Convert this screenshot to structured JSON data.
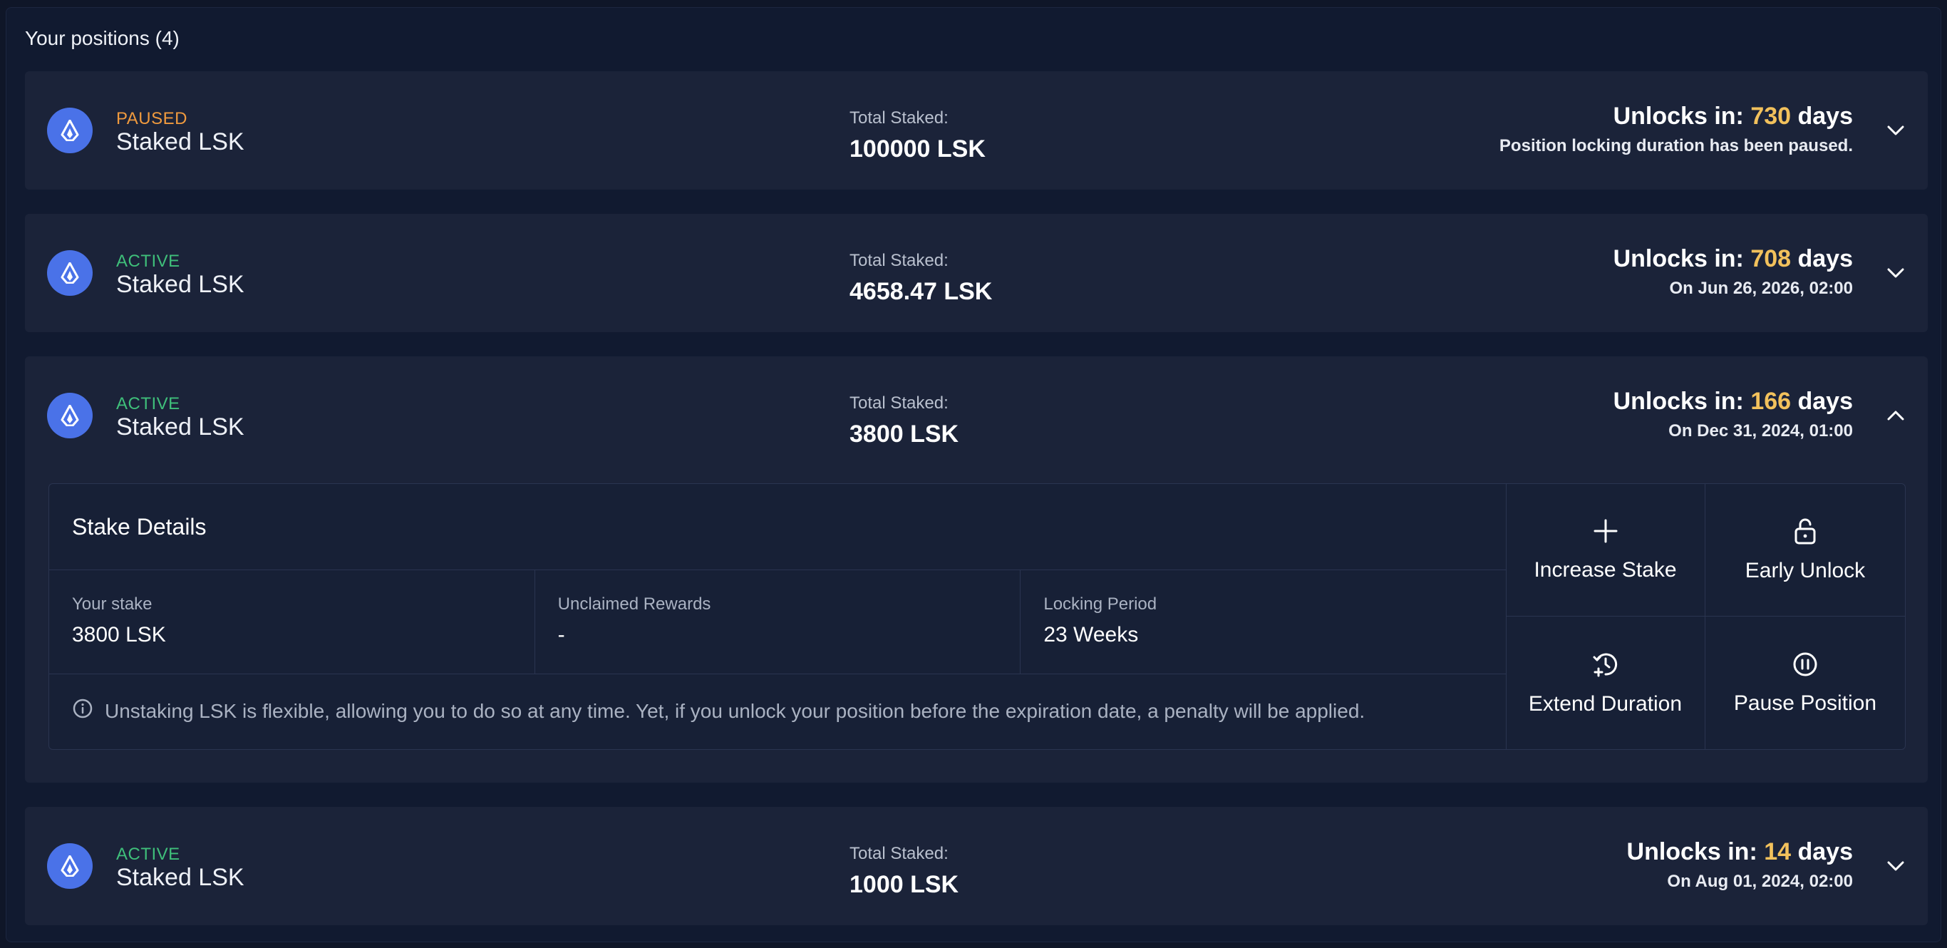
{
  "heading": "Your positions (4)",
  "staked_label": "Total Staked:",
  "unlock_prefix": "Unlocks in:",
  "unlock_suffix": "days",
  "positions": [
    {
      "status": "PAUSED",
      "name": "Staked LSK",
      "total_staked": "100000 LSK",
      "unlock_days": "730",
      "subtext": "Position locking duration has been paused.",
      "expanded": false
    },
    {
      "status": "ACTIVE",
      "name": "Staked LSK",
      "total_staked": "4658.47 LSK",
      "unlock_days": "708",
      "subtext": "On Jun 26, 2026, 02:00",
      "expanded": false
    },
    {
      "status": "ACTIVE",
      "name": "Staked LSK",
      "total_staked": "3800 LSK",
      "unlock_days": "166",
      "subtext": "On Dec 31, 2024, 01:00",
      "expanded": true
    },
    {
      "status": "ACTIVE",
      "name": "Staked LSK",
      "total_staked": "1000 LSK",
      "unlock_days": "14",
      "subtext": "On Aug 01, 2024, 02:00",
      "expanded": false
    }
  ],
  "details": {
    "title": "Stake Details",
    "fields": [
      {
        "label": "Your stake",
        "value": "3800 LSK"
      },
      {
        "label": "Unclaimed Rewards",
        "value": "-"
      },
      {
        "label": "Locking Period",
        "value": "23 Weeks"
      }
    ],
    "note": "Unstaking LSK is flexible, allowing you to do so at any time. Yet, if you unlock your position before the expiration date, a penalty will be applied.",
    "actions": [
      {
        "label": "Increase Stake",
        "icon": "plus-icon"
      },
      {
        "label": "Early Unlock",
        "icon": "unlock-icon"
      },
      {
        "label": "Extend Duration",
        "icon": "clock-plus-icon"
      },
      {
        "label": "Pause Position",
        "icon": "pause-circle-icon"
      }
    ]
  },
  "colors": {
    "paused": "#f09a3e",
    "active": "#3fbf7a",
    "days": "#f2c15c",
    "logo": "#4a72e8"
  }
}
